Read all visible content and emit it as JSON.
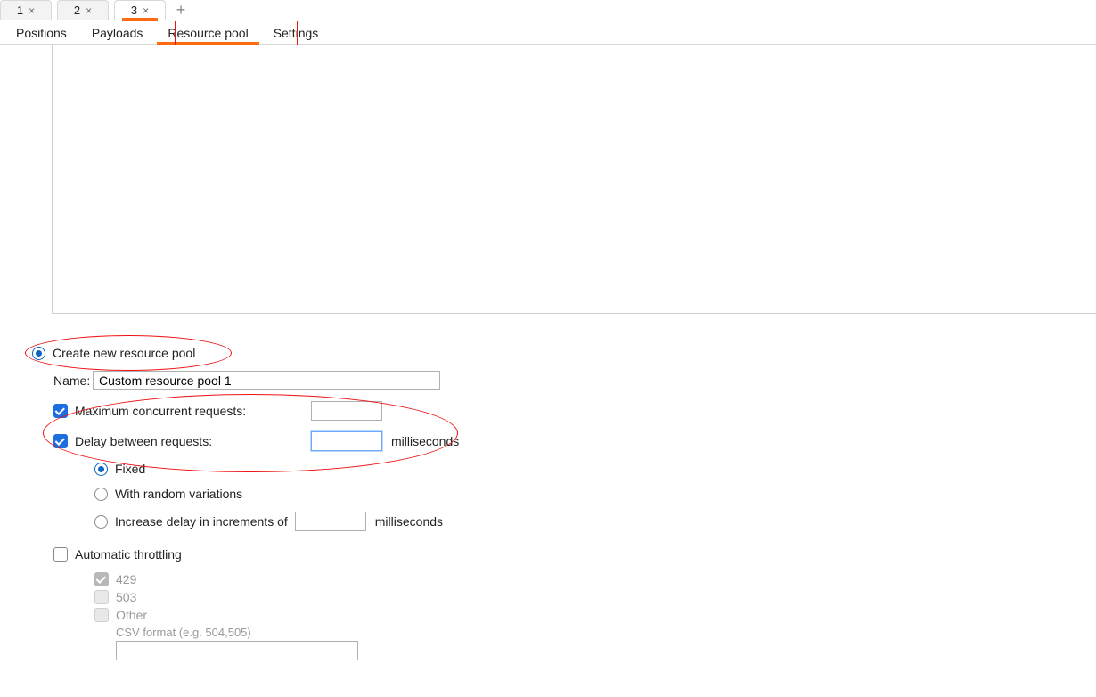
{
  "top_tabs": {
    "items": [
      {
        "label": "1",
        "active": false
      },
      {
        "label": "2",
        "active": false
      },
      {
        "label": "3",
        "active": true
      }
    ],
    "add_label": "+"
  },
  "menu_tabs": {
    "items": [
      {
        "label": "Positions",
        "active": false
      },
      {
        "label": "Payloads",
        "active": false
      },
      {
        "label": "Resource pool",
        "active": true
      },
      {
        "label": "Settings",
        "active": false
      }
    ]
  },
  "form": {
    "create_new_label": "Create new resource pool",
    "name_label": "Name:",
    "name_value": "Custom resource pool 1",
    "max_concurrent_label": "Maximum concurrent requests:",
    "max_concurrent_value": "",
    "delay_label": "Delay between requests:",
    "delay_value": "",
    "delay_unit": "milliseconds",
    "delay_mode": {
      "fixed": "Fixed",
      "random": "With random variations",
      "increment_prefix": "Increase delay in increments of",
      "increment_value": "",
      "increment_unit": "milliseconds"
    },
    "auto_throttle_label": "Automatic throttling",
    "status_codes": {
      "c429": "429",
      "c503": "503",
      "other": "Other"
    },
    "csv_placeholder": "CSV format (e.g. 504,505)",
    "csv_value": ""
  }
}
